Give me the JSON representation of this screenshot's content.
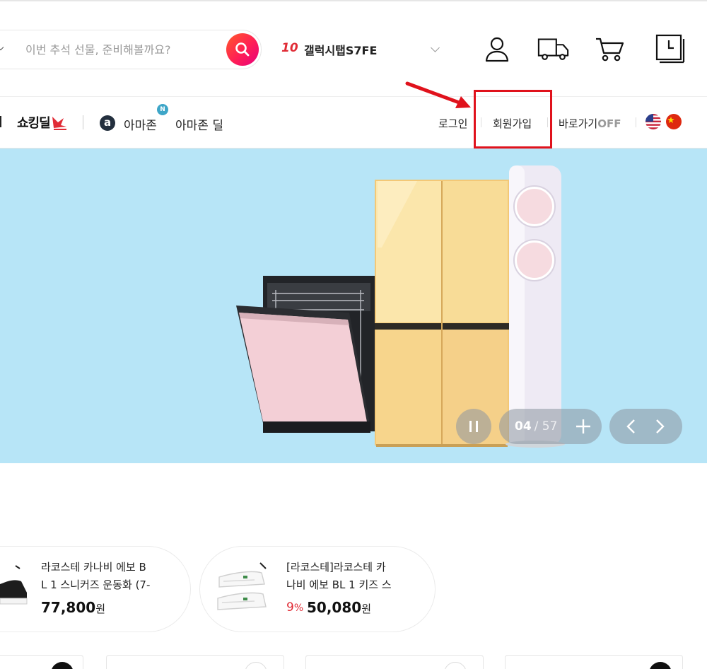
{
  "search": {
    "placeholder": "이번 추석 선물, 준비해볼까요?"
  },
  "trending": {
    "rank": "10",
    "keyword": "갤럭시탭S7FE"
  },
  "header_icons": [
    "user-icon",
    "delivery-truck-icon",
    "cart-icon",
    "recent-view-icon"
  ],
  "nav": {
    "shopping_deal": "쇼킹딜",
    "amazon": "아마존",
    "amazon_logo": "a",
    "new_badge": "N",
    "amazon_deal": "아마존 딜"
  },
  "util": {
    "login": "로그인",
    "signup": "회원가입",
    "shortcut": "바로가기",
    "shortcut_state": "OFF"
  },
  "hero": {
    "pager_current": "04",
    "pager_total": "/ 57",
    "background": "#b7e5f7"
  },
  "products": [
    {
      "title_line1": "라코스테 카나비 에보 B",
      "title_line2": "L 1 스니커즈 운동화 (7-",
      "price": "77,800",
      "currency": "원"
    },
    {
      "title_line1": "[라코스테]라코스테 카",
      "title_line2": "나비 에보 BL 1 키즈 스",
      "discount": "9",
      "discount_unit": "%",
      "price": "50,080",
      "currency": "원"
    }
  ],
  "colors": {
    "accent": "#e02b35",
    "search_gradient": "#ff1e55",
    "annotation": "#e0121c"
  }
}
